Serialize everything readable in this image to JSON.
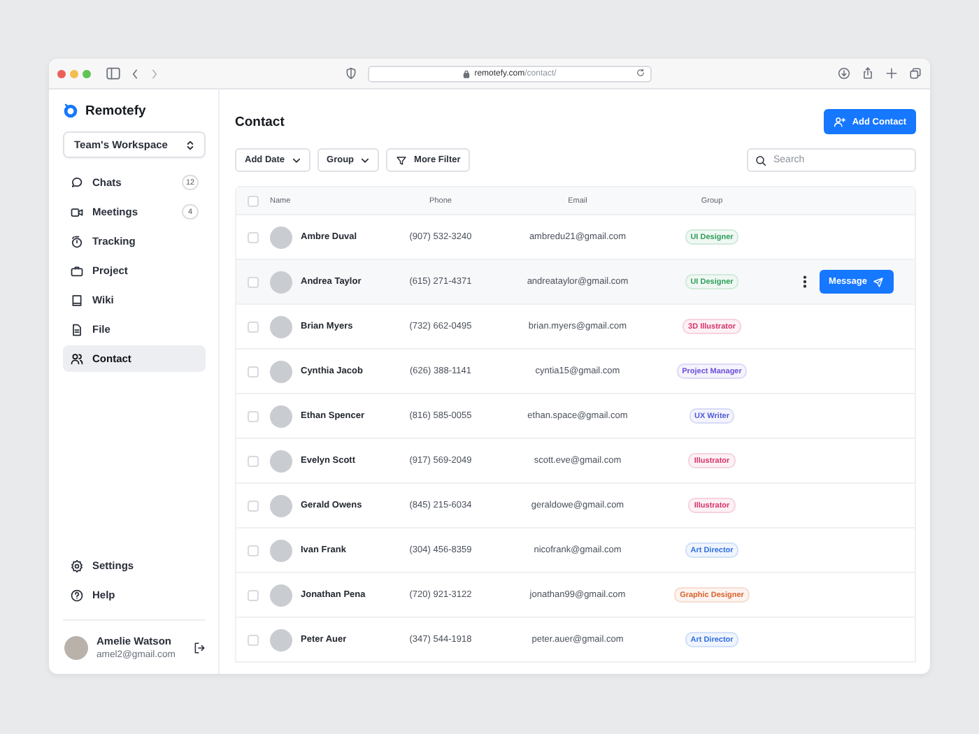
{
  "browser": {
    "url": {
      "host": "remotefy.com",
      "path": "/contact/"
    }
  },
  "sidebar": {
    "logo": "Remotefy",
    "workspace": "Team's Workspace",
    "nav": [
      {
        "label": "Chats",
        "badge": "12",
        "selected": false
      },
      {
        "label": "Meetings",
        "badge": "4",
        "selected": false
      },
      {
        "label": "Tracking",
        "selected": false
      },
      {
        "label": "Project",
        "selected": false
      },
      {
        "label": "Wiki",
        "selected": false
      },
      {
        "label": "File",
        "selected": false
      },
      {
        "label": "Contact",
        "selected": true
      }
    ],
    "bottom_nav": [
      {
        "label": "Settings"
      },
      {
        "label": "Help"
      }
    ],
    "user": {
      "name": "Amelie Watson",
      "email": "amel2@gmail.com"
    }
  },
  "main": {
    "title": "Contact",
    "add_button": "Add Contact",
    "filters": [
      {
        "label": "Add Date",
        "kind": "dropdown"
      },
      {
        "label": "Group",
        "kind": "dropdown"
      },
      {
        "label": "More Filter",
        "kind": "filter"
      }
    ],
    "search": {
      "placeholder": "Search"
    },
    "table": {
      "select_all_checked": false,
      "columns": [
        "Name",
        "Phone",
        "Email",
        "Group"
      ],
      "row_action": "Message",
      "rows": [
        {
          "name": "Ambre Duval",
          "phone": "(907) 532-3240",
          "email": "ambredu21@gmail.com",
          "group": "UI Designer",
          "color": "#2e9e5b",
          "checked": false,
          "highlighted": false
        },
        {
          "name": "Andrea Taylor",
          "phone": "(615) 271-4371",
          "email": "andreataylor@gmail.com",
          "group": "UI Designer",
          "color": "#2e9e5b",
          "checked": false,
          "highlighted": true
        },
        {
          "name": "Brian Myers",
          "phone": "(732) 662-0495",
          "email": "brian.myers@gmail.com",
          "group": "3D Illustrator",
          "color": "#d6336c",
          "checked": false,
          "highlighted": false
        },
        {
          "name": "Cynthia Jacob",
          "phone": "(626) 388-1141",
          "email": "cyntia15@gmail.com",
          "group": "Project Manager",
          "color": "#6c4ed9",
          "checked": false,
          "highlighted": false
        },
        {
          "name": "Ethan Spencer",
          "phone": "(816) 585-0055",
          "email": "ethan.space@gmail.com",
          "group": "UX Writer",
          "color": "#4f5bd5",
          "checked": false,
          "highlighted": false
        },
        {
          "name": "Evelyn Scott",
          "phone": "(917) 569-2049",
          "email": "scott.eve@gmail.com",
          "group": "Illustrator",
          "color": "#d6336c",
          "checked": false,
          "highlighted": false
        },
        {
          "name": "Gerald Owens",
          "phone": "(845) 215-6034",
          "email": "geraldowe@gmail.com",
          "group": "Illustrator",
          "color": "#d6336c",
          "checked": false,
          "highlighted": false
        },
        {
          "name": "Ivan Frank",
          "phone": "(304) 456-8359",
          "email": "nicofrank@gmail.com",
          "group": "Art Director",
          "color": "#2f6fdf",
          "checked": false,
          "highlighted": false
        },
        {
          "name": "Jonathan Pena",
          "phone": "(720) 921-3122",
          "email": "jonathan99@gmail.com",
          "group": "Graphic Designer",
          "color": "#d9622b",
          "checked": false,
          "highlighted": false
        },
        {
          "name": "Peter Auer",
          "phone": "(347) 544-1918",
          "email": "peter.auer@gmail.com",
          "group": "Art Director",
          "color": "#2f6fdf",
          "checked": false,
          "highlighted": false
        }
      ]
    }
  }
}
